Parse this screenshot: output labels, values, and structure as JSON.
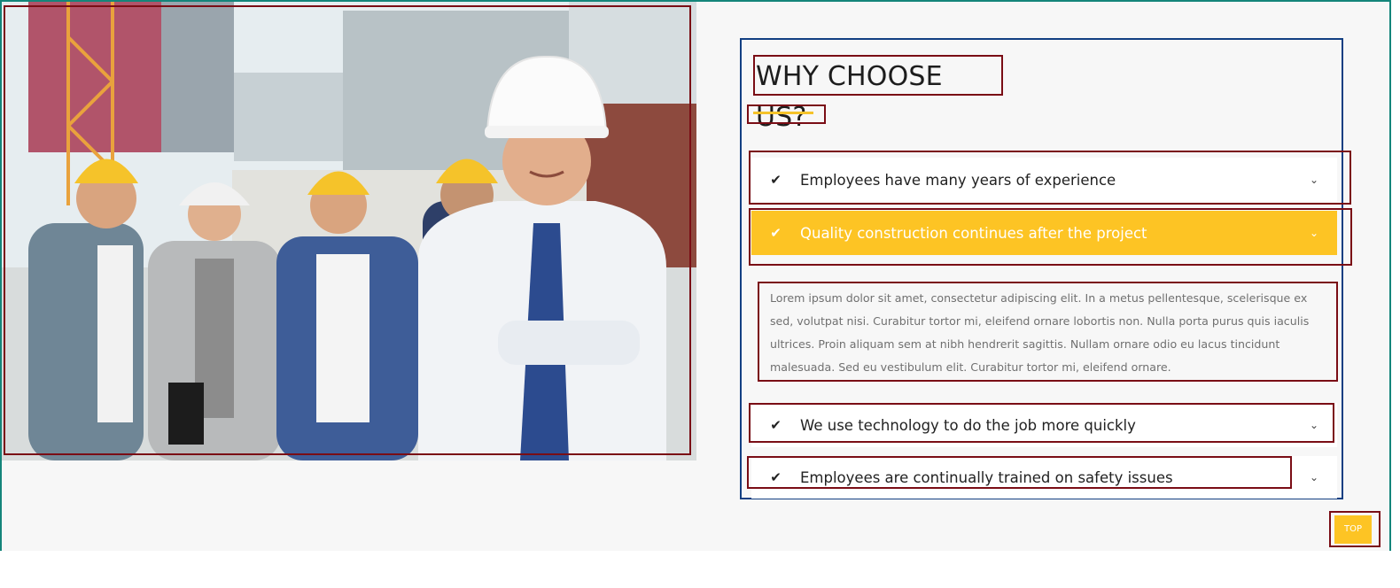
{
  "section": {
    "title": "WHY CHOOSE US?",
    "accent_color": "#fdc424",
    "accordion": [
      {
        "label": "Employees have many years of experience",
        "expanded": false
      },
      {
        "label": "Quality construction continues after the project",
        "expanded": true,
        "body": "Lorem ipsum dolor sit amet, consectetur adipiscing elit. In a metus pellentesque, scelerisque ex sed, volutpat nisi. Curabitur tortor mi, eleifend ornare lobortis non. Nulla porta purus quis iaculis ultrices. Proin aliquam sem at nibh hendrerit sagittis. Nullam ornare odio eu lacus tincidunt malesuada. Sed eu vestibulum elit. Curabitur tortor mi, eleifend ornare."
      },
      {
        "label": "We use technology to do the job more quickly",
        "expanded": false
      },
      {
        "label": "Employees are continually trained on safety issues",
        "expanded": false
      }
    ]
  },
  "icons": {
    "check": "check-icon",
    "chevron": "chevron-down-icon"
  },
  "scroll_top": {
    "label": "TOP"
  }
}
